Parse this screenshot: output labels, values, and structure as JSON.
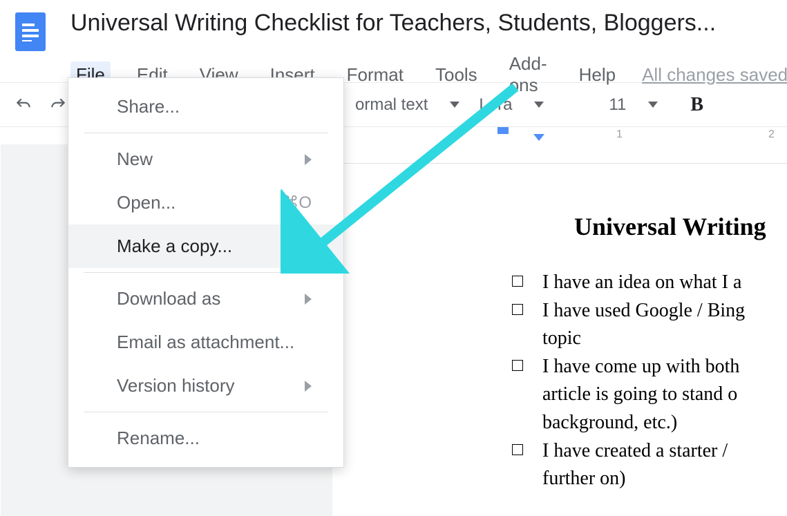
{
  "document": {
    "title": "Universal Writing Checklist for Teachers, Students, Bloggers..."
  },
  "menubar": {
    "items": [
      "File",
      "Edit",
      "View",
      "Insert",
      "Format",
      "Tools",
      "Add-ons",
      "Help"
    ],
    "save_status": "All changes saved i"
  },
  "toolbar": {
    "style_select": "ormal text",
    "font_select": "Lora",
    "font_size": "11",
    "bold": "B"
  },
  "ruler": {
    "labels": [
      "1",
      "1",
      "2"
    ]
  },
  "file_menu": {
    "share": "Share...",
    "new": "New",
    "open": "Open...",
    "open_shortcut": "⌘O",
    "make_copy": "Make a copy...",
    "download_as": "Download as",
    "email_attachment": "Email as attachment...",
    "version_history": "Version history",
    "rename": "Rename..."
  },
  "page": {
    "heading": "Universal Writing",
    "items": [
      {
        "line1": "I have an idea on what I a"
      },
      {
        "line1": "I have used Google / Bing",
        "cont": "topic"
      },
      {
        "line1": "I have come up with both",
        "cont1": "article is going to stand o",
        "cont2": "background, etc.)"
      },
      {
        "line1": "I have created a starter /",
        "cont": "further on)"
      }
    ]
  },
  "annotation": {
    "color": "#2fd8e0"
  }
}
